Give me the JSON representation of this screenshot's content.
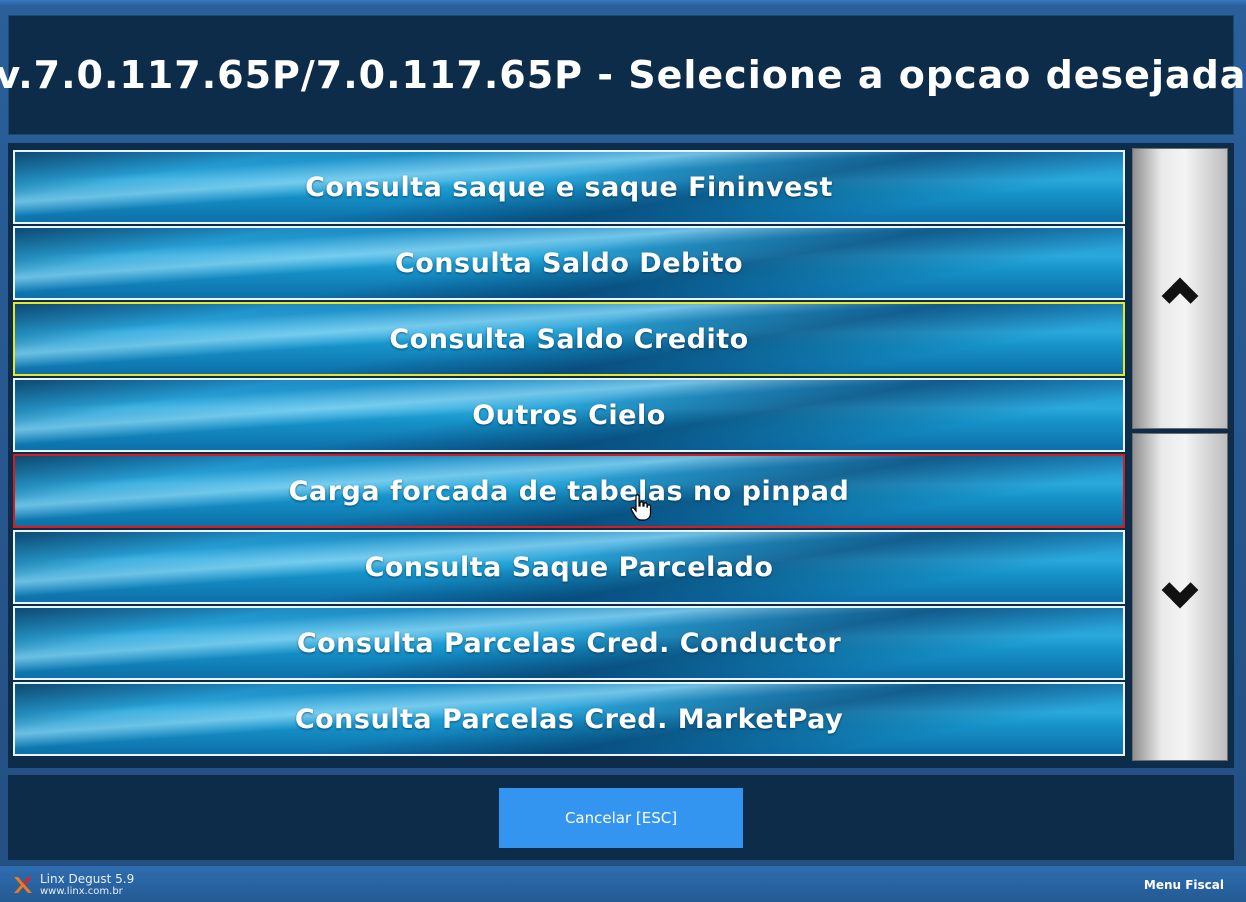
{
  "header": {
    "title": "v.7.0.117.65P/7.0.117.65P - Selecione a opcao desejada"
  },
  "options": [
    {
      "label": "Consulta saque e saque Fininvest",
      "state": "normal"
    },
    {
      "label": "Consulta Saldo Debito",
      "state": "normal"
    },
    {
      "label": "Consulta Saldo Credito",
      "state": "focus"
    },
    {
      "label": "Outros Cielo",
      "state": "normal"
    },
    {
      "label": "Carga forcada de tabelas no pinpad",
      "state": "selected"
    },
    {
      "label": "Consulta Saque Parcelado",
      "state": "normal"
    },
    {
      "label": "Consulta Parcelas Cred. Conductor",
      "state": "normal"
    },
    {
      "label": "Consulta Parcelas Cred. MarketPay",
      "state": "normal"
    }
  ],
  "scroll": {
    "up_icon": "chevron-up-icon",
    "down_icon": "chevron-down-icon"
  },
  "footer": {
    "cancel_label": "Cancelar [ESC]"
  },
  "status_bar": {
    "brand_name": "Linx Degust 5.9",
    "brand_url": "www.linx.com.br",
    "menu_label": "Menu Fiscal"
  },
  "colors": {
    "panel_bg": "#0d2c4a",
    "option_blue": "#2aa8dc",
    "focus_border": "#e6e62a",
    "selected_border": "#d81c1c",
    "cancel_bg": "#3395f0"
  }
}
